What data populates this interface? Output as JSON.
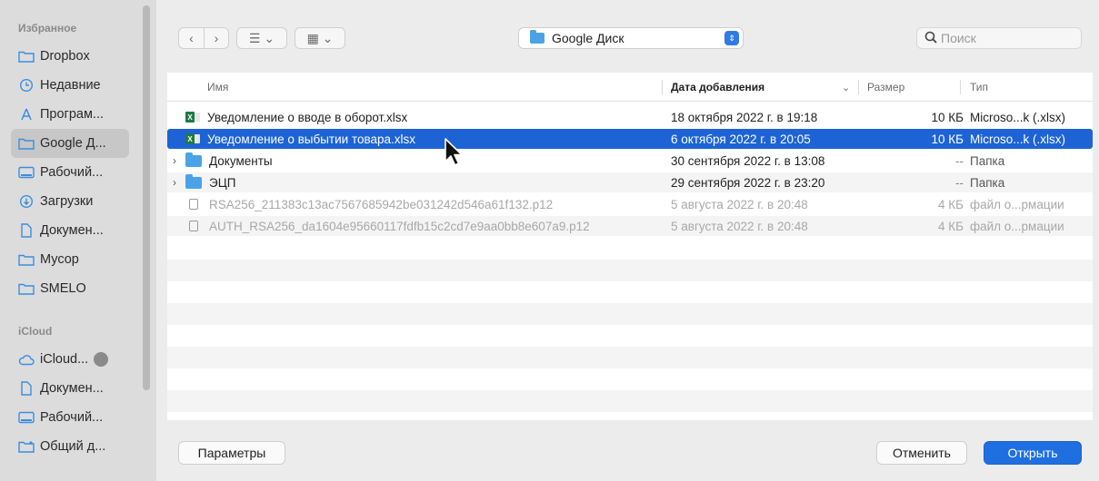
{
  "sidebar": {
    "favorites_header": "Избранное",
    "favorites": [
      {
        "label": "Dropbox",
        "icon": "folder-icon"
      },
      {
        "label": "Недавние",
        "icon": "clock-icon"
      },
      {
        "label": "Програм...",
        "icon": "apps-icon"
      },
      {
        "label": "Google Д...",
        "icon": "folder-icon",
        "selected": true
      },
      {
        "label": "Рабочий...",
        "icon": "desktop-icon"
      },
      {
        "label": "Загрузки",
        "icon": "download-icon"
      },
      {
        "label": "Докумен...",
        "icon": "document-icon"
      },
      {
        "label": "Мусор",
        "icon": "folder-icon"
      },
      {
        "label": "SMELO",
        "icon": "folder-icon"
      }
    ],
    "icloud_header": "iCloud",
    "icloud": [
      {
        "label": "iCloud...",
        "icon": "cloud-icon"
      },
      {
        "label": "Докумен...",
        "icon": "document-icon"
      },
      {
        "label": "Рабочий...",
        "icon": "desktop-icon"
      },
      {
        "label": "Общий д...",
        "icon": "shared-folder-icon"
      }
    ]
  },
  "toolbar": {
    "back": "‹",
    "forward": "›",
    "list_view": "☰ ⌄",
    "grid_view": "▦ ⌄",
    "location": "Google Диск",
    "search_placeholder": "Поиск"
  },
  "columns": {
    "name": "Имя",
    "date": "Дата добавления",
    "size": "Размер",
    "kind": "Тип"
  },
  "files": [
    {
      "name": "Уведомление о вводе в оборот.xlsx",
      "date": "18 октября 2022 г. в 19:18",
      "size": "10 КБ",
      "kind": "Microso...k (.xlsx)",
      "type": "xlsx"
    },
    {
      "name": "Уведомление о выбытии товара.xlsx",
      "date": "6 октября 2022 г. в 20:05",
      "size": "10 КБ",
      "kind": "Microso...k (.xlsx)",
      "type": "xlsx",
      "selected": true
    },
    {
      "name": "Документы",
      "date": "30 сентября 2022 г. в 13:08",
      "size": "--",
      "kind": "Папка",
      "type": "folder"
    },
    {
      "name": "ЭЦП",
      "date": "29 сентября 2022 г. в 23:20",
      "size": "--",
      "kind": "Папка",
      "type": "folder"
    },
    {
      "name": "RSA256_211383c13ac7567685942be031242d546a61f132.p12",
      "date": "5 августа 2022 г. в 20:48",
      "size": "4 КБ",
      "kind": "файл о...рмации",
      "type": "p12"
    },
    {
      "name": "AUTH_RSA256_da1604e95660117fdfb15c2cd7e9aa0bb8e607a9.p12",
      "date": "5 августа 2022 г. в 20:48",
      "size": "4 КБ",
      "kind": "файл о...рмации",
      "type": "p12"
    }
  ],
  "footer": {
    "options": "Параметры",
    "cancel": "Отменить",
    "open": "Открыть"
  },
  "colors": {
    "accent": "#1f6fe0",
    "selection": "#1d63d6",
    "folder": "#4aa3e6"
  }
}
